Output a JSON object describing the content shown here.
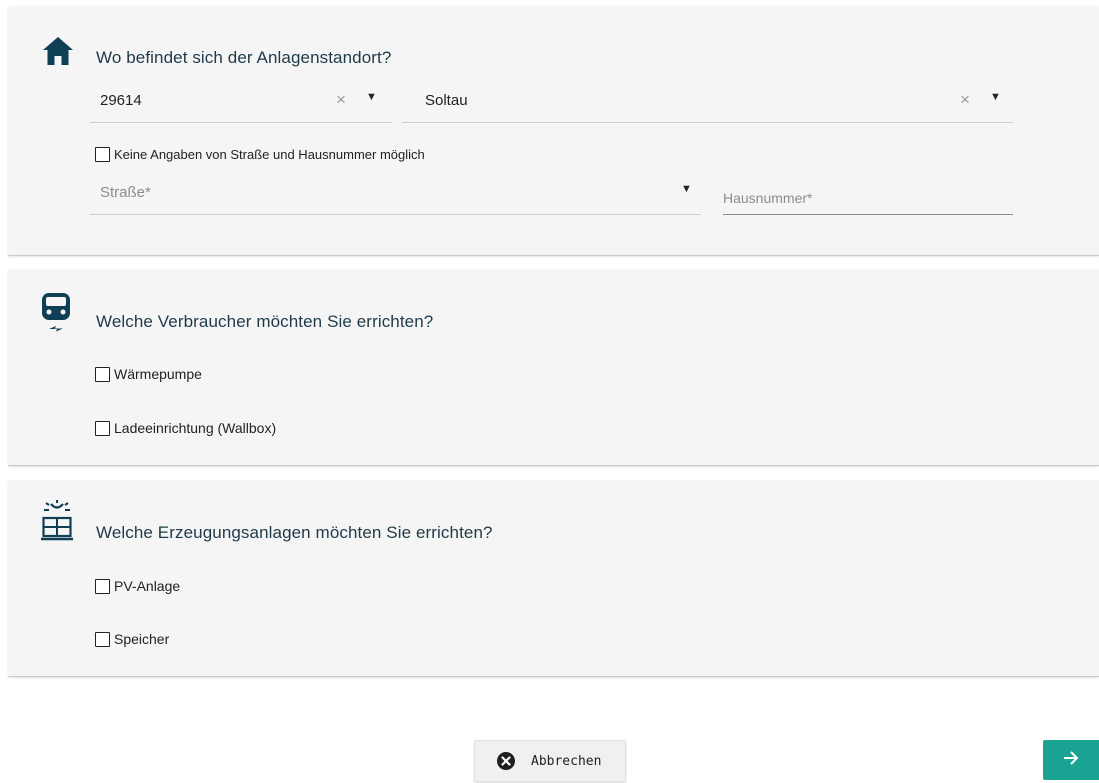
{
  "location": {
    "title": "Wo befindet sich der Anlagenstandort?",
    "icon": "home-icon",
    "zip_value": "29614",
    "city_value": "Soltau",
    "no_street_label": "Keine Angaben von Straße und Hausnummer möglich",
    "street_placeholder": "Straße*",
    "housenumber_placeholder": "Hausnummer*"
  },
  "consumers": {
    "title": "Welche Verbraucher möchten Sie errichten?",
    "icon": "car-charging-icon",
    "options": [
      "Wärmepumpe",
      "Ladeeinrichtung (Wallbox)"
    ]
  },
  "generators": {
    "title": "Welche Erzeugungsanlagen möchten Sie errichten?",
    "icon": "solar-panel-icon",
    "options": [
      "PV-Anlage",
      "Speicher"
    ]
  },
  "actions": {
    "cancel_label": "Abbrechen",
    "next_icon": "arrow-right-icon"
  },
  "colors": {
    "accent": "#1aa393",
    "icon": "#0f3f55",
    "card": "#f5f5f5"
  }
}
